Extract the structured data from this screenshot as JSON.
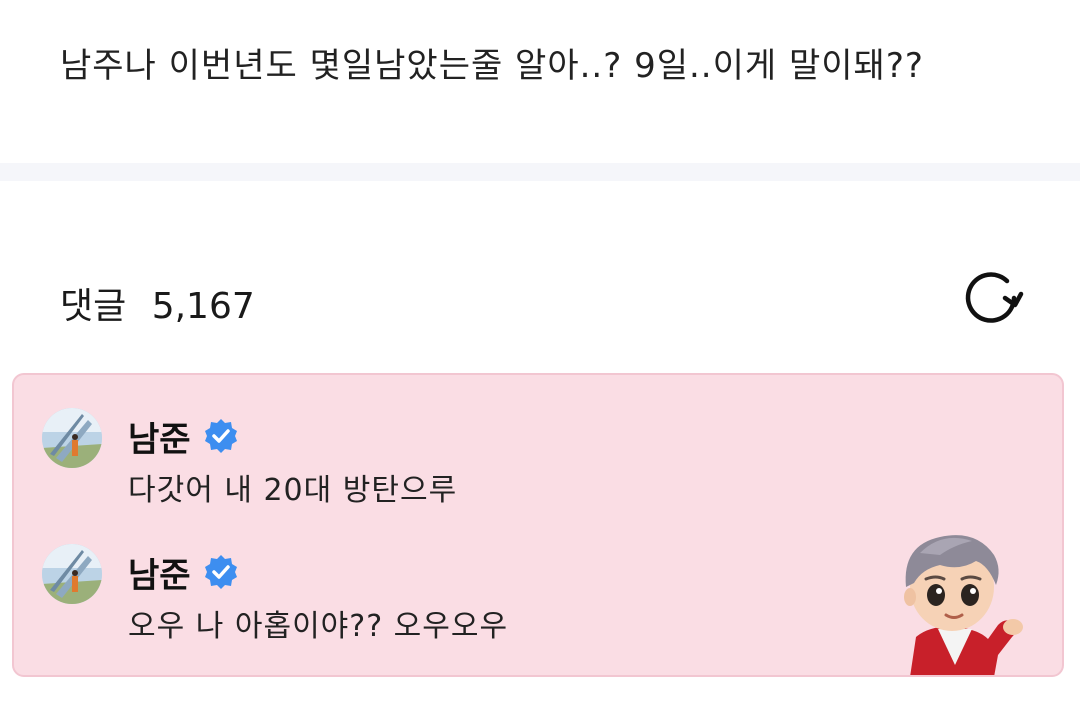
{
  "post": {
    "text": "남주나 이번년도 몇일남았는줄 알아..? 9일..이게 말이돼??"
  },
  "comments_section": {
    "label": "댓글",
    "count": "5,167",
    "refresh_icon": "refresh-icon"
  },
  "comments": [
    {
      "author": "남준",
      "verified": true,
      "text": "다갓어 내 20대 방탄으루"
    },
    {
      "author": "남준",
      "verified": true,
      "text": "오우 나 아홉이야?? 오우오우"
    }
  ],
  "colors": {
    "card_background": "#fadde4",
    "card_border": "#f2c6d1",
    "verified_badge": "#3d8ef0",
    "divider": "#f5f6fa"
  },
  "icons": {
    "verified": "verified-badge-icon",
    "sticker": "character-sticker"
  }
}
